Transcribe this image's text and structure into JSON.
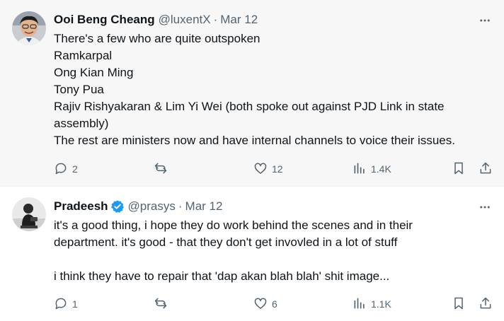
{
  "tweets": [
    {
      "name": "Ooi Beng Cheang",
      "handle": "@luxentX",
      "date": "Mar 12",
      "verified": false,
      "lines": [
        "There's a few who are quite outspoken",
        "Ramkarpal",
        "Ong Kian Ming",
        "Tony Pua",
        "Rajiv Rishyakaran & Lim Yi Wei (both spoke out against PJD Link in state",
        "assembly)",
        "The rest are ministers now and have internal channels to voice their issues."
      ],
      "replies": "2",
      "reposts": "",
      "likes": "12",
      "views": "1.4K"
    },
    {
      "name": "Pradeesh",
      "handle": "@prasys",
      "date": "Mar 12",
      "verified": true,
      "lines": [
        "it's a good thing, i hope they do work behind the scenes and in their",
        "department. it's good - that they don't get invovled in a lot of stuff",
        "",
        "i think they have to repair that 'dap akan blah blah' shit image..."
      ],
      "replies": "1",
      "reposts": "",
      "likes": "6",
      "views": "1.1K"
    }
  ],
  "icons": {
    "reply": "reply-icon",
    "repost": "repost-icon",
    "like": "like-icon",
    "views": "views-icon",
    "bookmark": "bookmark-icon",
    "share": "share-icon",
    "more": "more-icon",
    "verified": "verified-badge-icon"
  },
  "colors": {
    "text": "#0f1419",
    "secondary": "#536471",
    "verified": "#1d9bf0",
    "highlight_bg": "#f7f7f7"
  }
}
